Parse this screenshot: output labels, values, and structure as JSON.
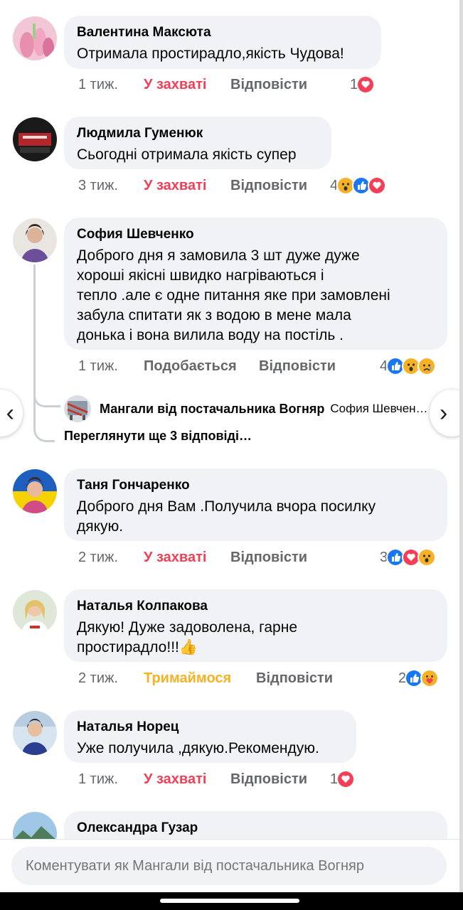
{
  "comments": [
    {
      "author": "Валентина Максюта",
      "text": "Отримала простирадло,якість Чудова!",
      "time": "1 тиж.",
      "reaction_label": "У захваті",
      "reply_label": "Відповісти",
      "reaction_count": "1",
      "reaction_icons": [
        "love"
      ]
    },
    {
      "author": "Людмила Гуменюк",
      "text": "Сьогодні отримала якість супер",
      "time": "3 тиж.",
      "reaction_label": "У захваті",
      "reply_label": "Відповісти",
      "reaction_count": "4",
      "reaction_icons": [
        "wow",
        "like",
        "love"
      ]
    },
    {
      "author": "София Шевченко",
      "text_lines": [
        "Доброго дня я замовила 3 шт дуже дуже",
        "хороші якісні швидко нагріваються і",
        "тепло .але є одне питання яке при замовлені",
        "забула спитати як з водою в мене мала",
        "донька і вона вилила воду на постіль ."
      ],
      "time": "1 тиж.",
      "reaction_label": "Подобається",
      "reply_label": "Відповісти",
      "reaction_count": "4",
      "reaction_icons": [
        "like",
        "wow",
        "sad"
      ]
    },
    {
      "author": "Таня Гончаренко",
      "text_lines": [
        "Доброго дня Вам .Получила вчора посилку",
        "дякую."
      ],
      "time": "2 тиж.",
      "reaction_label": "У захваті",
      "reply_label": "Відповісти",
      "reaction_count": "3",
      "reaction_icons": [
        "like",
        "love",
        "wow"
      ]
    },
    {
      "author": "Наталья Колпакова",
      "text_lines": [
        "Дякую! Дуже задоволена, гарне",
        "простирадло!!!👍"
      ],
      "time": "2 тиж.",
      "reaction_label": "Тримаймося",
      "reply_label": "Відповісти",
      "reaction_count": "2",
      "reaction_icons": [
        "like",
        "care"
      ]
    },
    {
      "author": "Наталья Норец",
      "text": "Уже получила ,дякую.Рекомендую.",
      "time": "1 тиж.",
      "reaction_label": "У захваті",
      "reply_label": "Відповісти",
      "reaction_count": "1",
      "reaction_icons": [
        "love"
      ]
    },
    {
      "author": "Олександра Гузар"
    }
  ],
  "reply": {
    "author": "Мангали від постачальника Вогняр",
    "preview": "София Шевчен…"
  },
  "more_replies": "Переглянути ще 3 відповіді…",
  "nav": {
    "left": "‹",
    "right": "›"
  },
  "composer": {
    "placeholder": "Коментувати як Мангали від постачальника Вогняр"
  },
  "colors": {
    "love": "#f33e58",
    "like": "#1877f2",
    "wow": "#f7b125",
    "care": "#f7b125",
    "sad": "#f7b125",
    "bubble": "#f0f2f5"
  }
}
